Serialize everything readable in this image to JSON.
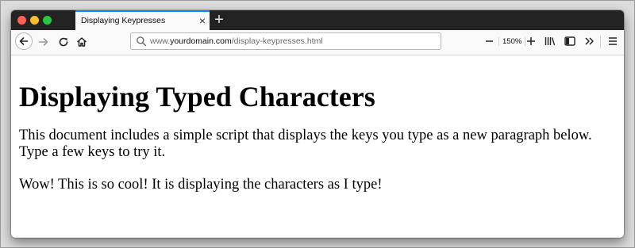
{
  "browser": {
    "tab": {
      "title": "Displaying Keypresses",
      "close_glyph": "×"
    },
    "new_tab_glyph": "+",
    "url": {
      "prefix": "www.",
      "domain": "yourdomain.com",
      "path": "/display-keypresses.html"
    },
    "zoom": {
      "minus_glyph": "−",
      "level": "150%",
      "plus_glyph": "+"
    },
    "icons": {
      "back": "back-arrow-icon",
      "forward": "forward-arrow-icon",
      "reload": "reload-icon",
      "home": "home-icon",
      "search": "search-icon",
      "library": "library-icon",
      "sidebar": "sidebar-icon",
      "overflow": "overflow-chevrons-icon",
      "menu": "hamburger-menu-icon"
    },
    "colors": {
      "titlebar": "#232323",
      "active_tab_accent": "#0a84ff",
      "close_light": "#fe5f57",
      "minimize_light": "#febc2e",
      "zoom_light": "#29c840"
    }
  },
  "page": {
    "heading": "Displaying Typed Characters",
    "intro": "This document includes a simple script that displays the keys you type as a new paragraph below. Type a few keys to try it.",
    "typed_output": "Wow! This is so cool! It is displaying the characters as I type!"
  }
}
